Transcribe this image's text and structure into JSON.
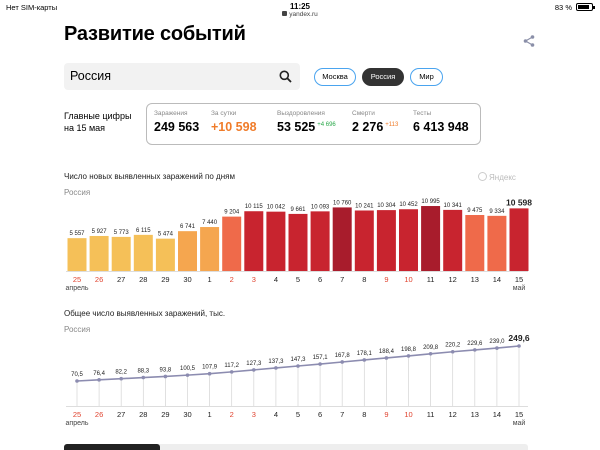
{
  "status": {
    "carrier": "Нет SIM-карты",
    "time": "11:25",
    "battery_percent": "83 %",
    "battery_level": 0.83,
    "url": "yandex.ru"
  },
  "header": {
    "title": "Развитие событий",
    "share_icon": "share-icon"
  },
  "search": {
    "value": "Россия",
    "icon": "search-icon"
  },
  "filters": [
    {
      "label": "Москва",
      "active": false
    },
    {
      "label": "Россия",
      "active": true
    },
    {
      "label": "Мир",
      "active": false
    }
  ],
  "key_figures": {
    "label_line1": "Главные цифры",
    "label_line2": "на 15 мая",
    "stats": [
      {
        "label": "Заражения",
        "value": "249 563",
        "delta": "",
        "color": "#000000"
      },
      {
        "label": "За сутки",
        "value": "+10 598",
        "delta": "",
        "color": "#f07c2a"
      },
      {
        "label": "Выздоровления",
        "value": "53 525",
        "delta": "+4 696",
        "delta_color": "#2aa84a",
        "color": "#000000"
      },
      {
        "label": "Смерти",
        "value": "2 276",
        "delta": "+113",
        "delta_color": "#f07c2a",
        "color": "#000000"
      },
      {
        "label": "Тесты",
        "value": "6 413 948",
        "delta": "",
        "color": "#000000"
      }
    ]
  },
  "brand_mark": "Яндекс",
  "chart_data": [
    {
      "type": "bar",
      "title": "Число новых выявленных заражений по дням",
      "subtitle": "Россия",
      "categories": [
        "25",
        "26",
        "27",
        "28",
        "29",
        "30",
        "1",
        "2",
        "3",
        "4",
        "5",
        "6",
        "7",
        "8",
        "9",
        "10",
        "11",
        "12",
        "13",
        "14",
        "15"
      ],
      "month_labels": [
        {
          "index": 0,
          "text": "апрель"
        },
        {
          "index": 20,
          "text": "май"
        }
      ],
      "holiday_indices": [
        0,
        1,
        7,
        8,
        14,
        15
      ],
      "values": [
        5557,
        5927,
        5773,
        6115,
        5474,
        6741,
        7440,
        9204,
        10115,
        10042,
        9661,
        10093,
        10760,
        10241,
        10304,
        10452,
        10995,
        10341,
        9475,
        9334,
        10598
      ],
      "value_labels": [
        "5 557",
        "5 927",
        "5 773",
        "6 115",
        "5 474",
        "6 741",
        "7 440",
        "9 204",
        "10 115",
        "10 042",
        "9 661",
        "10 093",
        "10 760",
        "10 241",
        "10 304",
        "10 452",
        "10 995",
        "10 341",
        "9 475",
        "9 334",
        "10 598"
      ],
      "bar_colors": [
        "#f5c058",
        "#f5c058",
        "#f5c058",
        "#f5c058",
        "#f5c058",
        "#f5a64f",
        "#f5a64f",
        "#ef6a4a",
        "#c8242f",
        "#c8242f",
        "#c8242f",
        "#c8242f",
        "#a81c2c",
        "#c8242f",
        "#c8242f",
        "#c8242f",
        "#a81c2c",
        "#c8242f",
        "#ef6a4a",
        "#ef6a4a",
        "#c8242f"
      ],
      "ylim": [
        0,
        11000
      ]
    },
    {
      "type": "line",
      "title": "Общее число выявленных заражений, тыс.",
      "subtitle": "Россия",
      "categories": [
        "25",
        "26",
        "27",
        "28",
        "29",
        "30",
        "1",
        "2",
        "3",
        "4",
        "5",
        "6",
        "7",
        "8",
        "9",
        "10",
        "11",
        "12",
        "13",
        "14",
        "15"
      ],
      "month_labels": [
        {
          "index": 0,
          "text": "апрель"
        },
        {
          "index": 20,
          "text": "май"
        }
      ],
      "holiday_indices": [
        0,
        1,
        7,
        8,
        14,
        15
      ],
      "values": [
        70.5,
        76.4,
        82.2,
        88.3,
        93.8,
        100.5,
        107.9,
        117.2,
        127.3,
        137.3,
        147.3,
        157.1,
        167.8,
        178.1,
        188.4,
        198.8,
        209.8,
        220.2,
        229.6,
        239.0,
        249.6
      ],
      "value_labels": [
        "70,5",
        "76,4",
        "82,2",
        "88,3",
        "93,8",
        "100,5",
        "107,9",
        "117,2",
        "127,3",
        "137,3",
        "147,3",
        "157,1",
        "167,8",
        "178,1",
        "188,4",
        "198,8",
        "209,8",
        "220,2",
        "229,6",
        "239,0",
        "249,6"
      ],
      "line_color": "#8c8cb0",
      "ylim": [
        0,
        260
      ]
    }
  ],
  "colors": {
    "accent_blue": "#4aa4ef",
    "holiday_red": "#e0432f",
    "label_gray": "#888888"
  }
}
